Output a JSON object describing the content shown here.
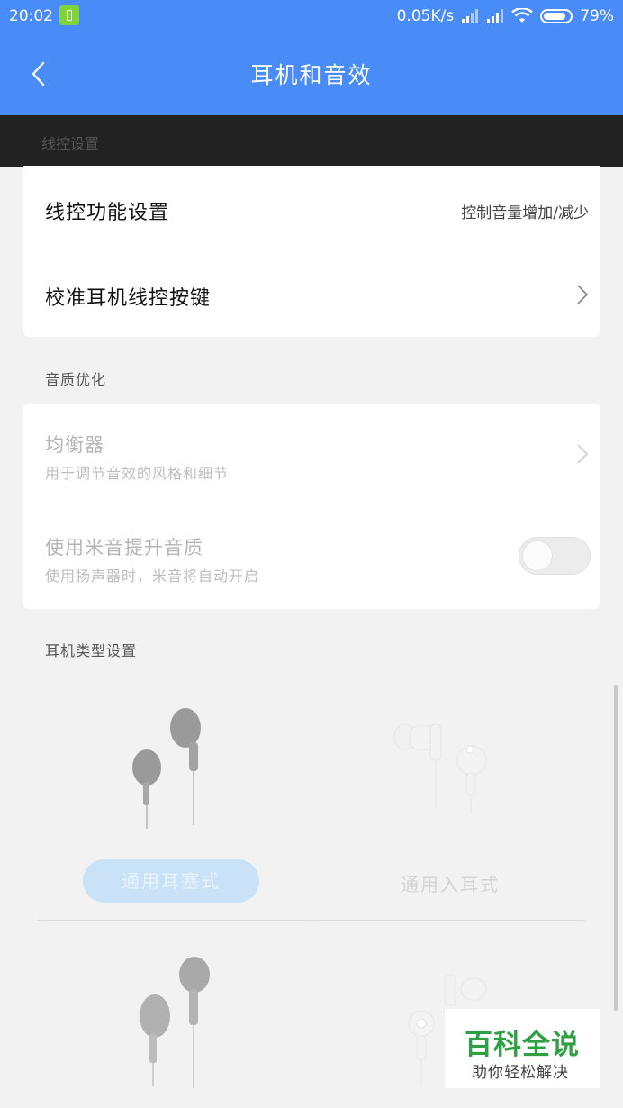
{
  "status_bar": {
    "time": "20:02",
    "net_speed": "0.05K/s",
    "battery_percent": "79%",
    "icons": [
      "battery-saver-icon",
      "signal-icon",
      "signal-icon",
      "wifi-icon",
      "battery-icon"
    ]
  },
  "header": {
    "title": "耳机和音效",
    "back_icon": "chevron-left-icon",
    "bg_color": "#4a8cf7"
  },
  "overlay_section_label": "线控设置",
  "wire_control": {
    "function_setting_label": "线控功能设置",
    "function_setting_value": "控制音量增加/减少",
    "calibrate_label": "校准耳机线控按键"
  },
  "quality": {
    "section_label": "音质优化",
    "equalizer_title": "均衡器",
    "equalizer_subtitle": "用于调节音效的风格和细节",
    "mi_sound_title": "使用米音提升音质",
    "mi_sound_subtitle": "使用扬声器时，米音将自动开启",
    "mi_sound_enabled": false
  },
  "headphone_type": {
    "section_label": "耳机类型设置",
    "options": [
      {
        "label": "通用耳塞式",
        "selected": true
      },
      {
        "label": "通用入耳式",
        "selected": false
      }
    ]
  },
  "watermark": {
    "main": "百科全说",
    "sub": "助你轻松解决"
  }
}
